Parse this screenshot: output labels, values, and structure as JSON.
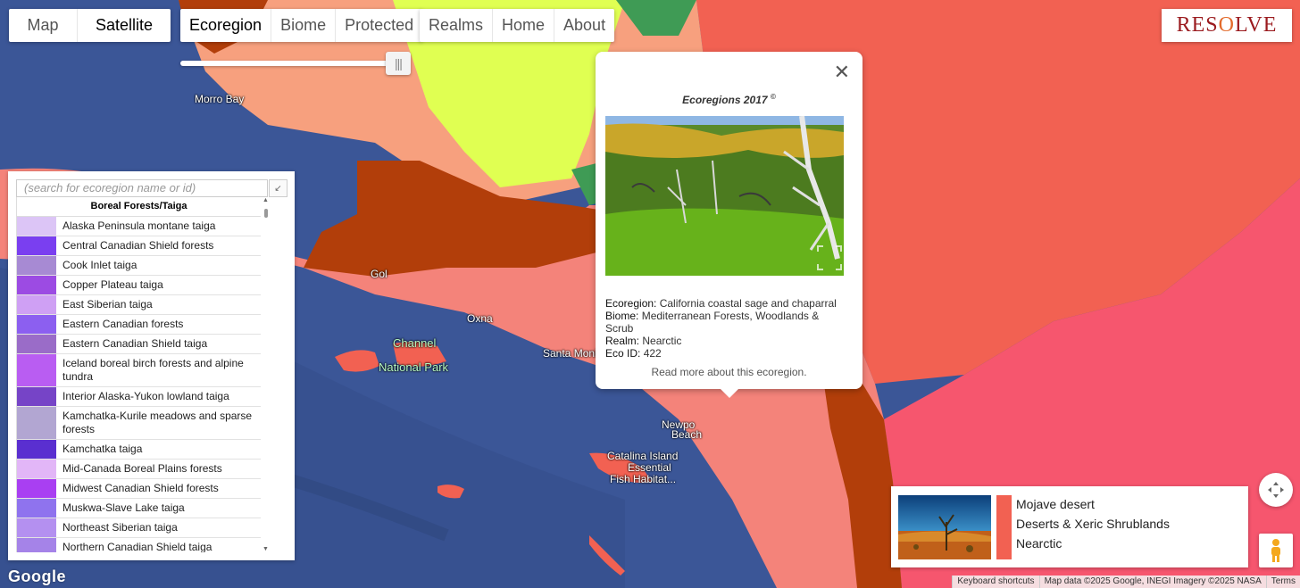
{
  "map_type": {
    "options": [
      "Map",
      "Satellite"
    ],
    "selected": "Satellite"
  },
  "layer_tabs": [
    "Ecoregion",
    "Biome",
    "Protected"
  ],
  "layer_selected": "Ecoregion",
  "nav_tabs": [
    "Realms",
    "Home",
    "About"
  ],
  "logo": {
    "text_before": "RES",
    "text_accent": "O",
    "text_after": "LVE"
  },
  "opacity_slider_value": 1.0,
  "legend": {
    "search_placeholder": "(search for ecoregion name or id)",
    "search_button_icon": "collapse-arrow-icon",
    "group_heading": "Boreal Forests/Taiga",
    "items": [
      {
        "name": "Alaska Peninsula montane taiga",
        "color": "#dcc5f6"
      },
      {
        "name": "Central Canadian Shield forests",
        "color": "#7a3ff0"
      },
      {
        "name": "Cook Inlet taiga",
        "color": "#a78ad3"
      },
      {
        "name": "Copper Plateau taiga",
        "color": "#9c4be3"
      },
      {
        "name": "East Siberian taiga",
        "color": "#cfa0f4"
      },
      {
        "name": "Eastern Canadian forests",
        "color": "#8c5ff0"
      },
      {
        "name": "Eastern Canadian Shield taiga",
        "color": "#9a6cc8"
      },
      {
        "name": "Iceland boreal birch forests and alpine tundra",
        "color": "#b95df2"
      },
      {
        "name": "Interior Alaska-Yukon lowland taiga",
        "color": "#7644c7"
      },
      {
        "name": "Kamchatka-Kurile meadows and sparse forests",
        "color": "#b2a6d2"
      },
      {
        "name": "Kamchatka taiga",
        "color": "#5a2fd0"
      },
      {
        "name": "Mid-Canada Boreal Plains forests",
        "color": "#e2b6f7"
      },
      {
        "name": "Midwest Canadian Shield forests",
        "color": "#a93ff2"
      },
      {
        "name": "Muskwa-Slave Lake taiga",
        "color": "#8f73ee"
      },
      {
        "name": "Northeast Siberian taiga",
        "color": "#b490f0"
      },
      {
        "name": "Northern Canadian Shield taiga",
        "color": "#a583e8"
      }
    ]
  },
  "popup": {
    "title": "Ecoregions 2017",
    "title_sup": "©",
    "ecoregion_label": "Ecoregion:",
    "ecoregion": "California coastal sage and chaparral",
    "biome_label": "Biome:",
    "biome": "Mediterranean Forests, Woodlands & Scrub",
    "realm_label": "Realm:",
    "realm": "Nearctic",
    "eco_id_label": "Eco ID:",
    "eco_id": "422",
    "read_more": "Read more about this ecoregion."
  },
  "hover_card": {
    "ecoregion": "Mojave desert",
    "biome": "Deserts & Xeric Shrublands",
    "realm": "Nearctic",
    "color": "#f26152"
  },
  "place_labels": {
    "morro_bay": "Morro Bay",
    "goleta": "Gol",
    "oxnard": "Oxna",
    "channel": "Channel",
    "national_park": "National Park",
    "santa_monica": "Santa Moni",
    "newport": "Newpo",
    "beach": "Beach",
    "catalina1": "Catalina Island",
    "catalina2": "Essential",
    "catalina3": "Fish Habitat..."
  },
  "footer": {
    "google": "Google",
    "keyboard_shortcuts": "Keyboard shortcuts",
    "map_data": "Map data ©2025 Google, INEGI Imagery ©2025 NASA",
    "terms": "Terms"
  },
  "colors": {
    "ocean": "#3b5697",
    "coastal_sage": "#f4837a",
    "pacific_shrub": "#f7a07e",
    "california_valley": "#e0ff52",
    "montane_forest": "#b23e0a",
    "mojave": "#f26152",
    "sonoran_pink": "#f6566e"
  }
}
